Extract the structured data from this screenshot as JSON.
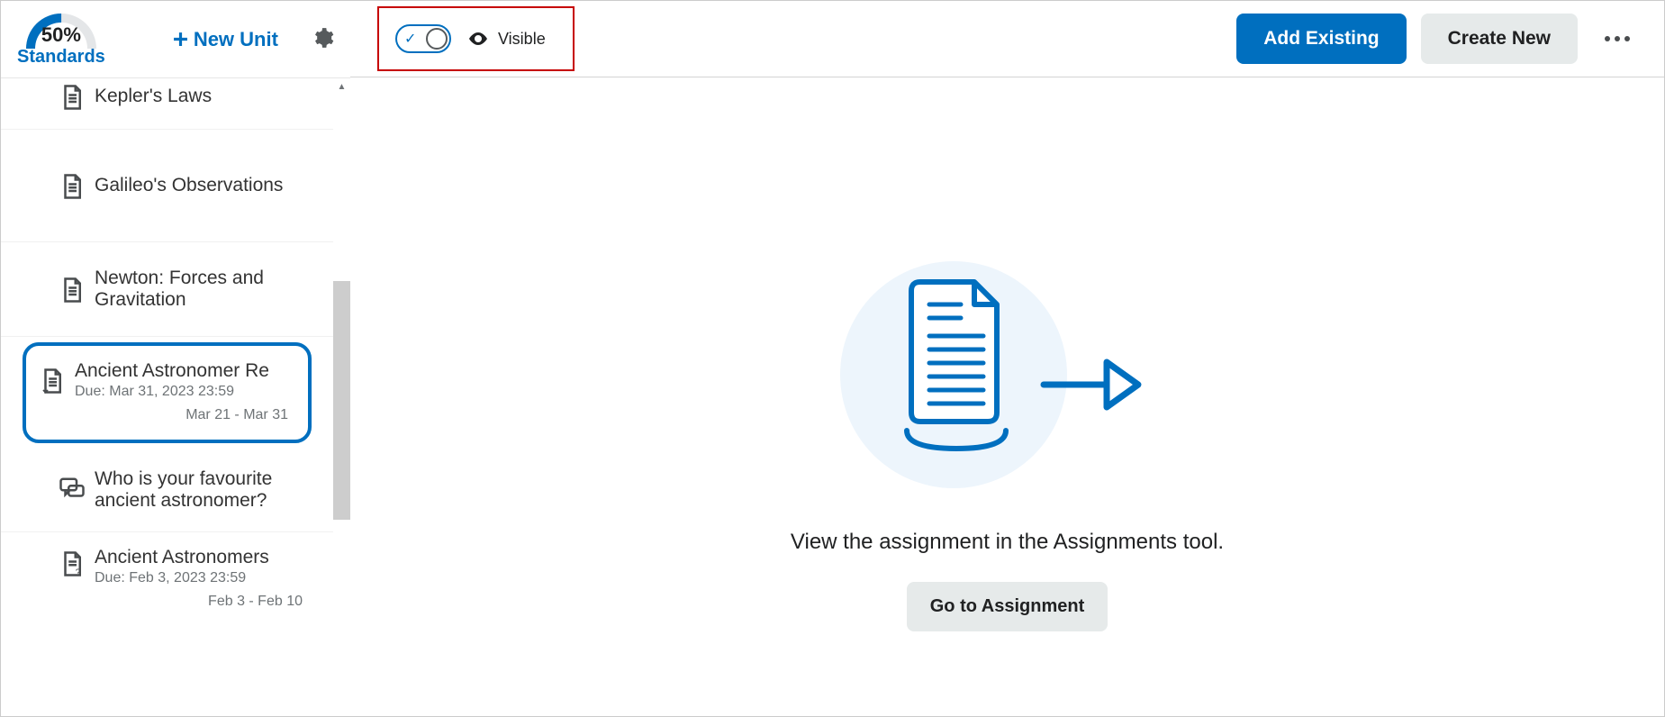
{
  "sidebar": {
    "progress_pct": "50%",
    "standards_label": "Standards",
    "new_unit_label": "New Unit",
    "items": [
      {
        "icon": "document-icon",
        "title": "Kepler's Laws"
      },
      {
        "icon": "document-icon",
        "title": "Galileo's Observations"
      },
      {
        "icon": "document-icon",
        "title": "Newton: Forces and Gravitation"
      },
      {
        "icon": "assignment-icon",
        "title": "Ancient Astronomer Re",
        "due": "Due: Mar 31, 2023 23:59",
        "range": "Mar 21 - Mar 31",
        "selected": true
      },
      {
        "icon": "discussion-icon",
        "title": "Who is your favourite ancient astronomer?"
      },
      {
        "icon": "quiz-icon",
        "title": "Ancient Astronomers",
        "due": "Due: Feb 3, 2023 23:59",
        "range": "Feb 3 - Feb 10"
      }
    ]
  },
  "topbar": {
    "visibility_label": "Visible",
    "add_existing_label": "Add Existing",
    "create_new_label": "Create New"
  },
  "main": {
    "empty_text": "View the assignment in the Assignments tool.",
    "go_label": "Go to Assignment"
  }
}
